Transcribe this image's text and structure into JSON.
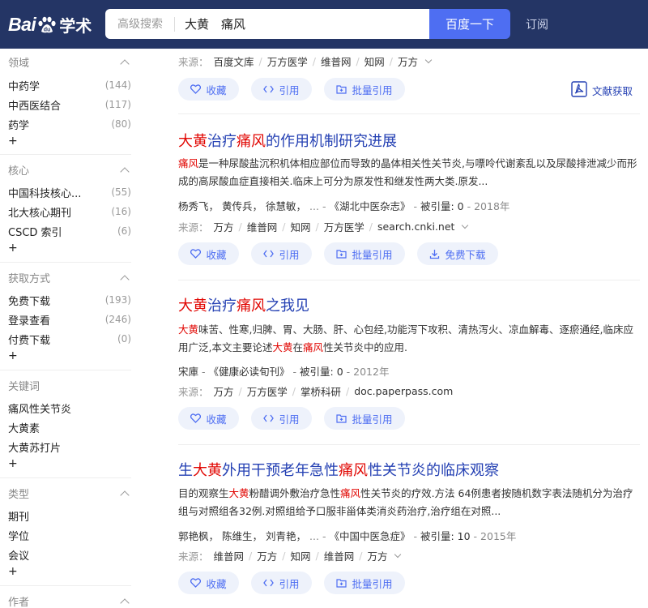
{
  "header": {
    "logo_text": "Bai",
    "logo_suffix": "学术",
    "advanced_search": "高级搜索",
    "query": "大黄　痛风",
    "search_button": "百度一下",
    "subscribe": "订阅"
  },
  "sidebar": {
    "groups": [
      {
        "title": "领域",
        "items": [
          {
            "label": "中药学",
            "count": "(144)"
          },
          {
            "label": "中西医结合",
            "count": "(117)"
          },
          {
            "label": "药学",
            "count": "(80)"
          }
        ],
        "more": "+"
      },
      {
        "title": "核心",
        "items": [
          {
            "label": "中国科技核心...",
            "count": "(55)"
          },
          {
            "label": "北大核心期刊",
            "count": "(16)"
          },
          {
            "label": "CSCD 索引",
            "count": "(6)"
          }
        ],
        "more": "+"
      },
      {
        "title": "获取方式",
        "items": [
          {
            "label": "免费下载",
            "count": "(193)"
          },
          {
            "label": "登录查看",
            "count": "(246)"
          },
          {
            "label": "付费下载",
            "count": "(0)"
          }
        ],
        "more": "+"
      },
      {
        "title": "关键词",
        "items": [
          {
            "label": "痛风性关节炎",
            "count": ""
          },
          {
            "label": "大黄素",
            "count": ""
          },
          {
            "label": "大黄苏打片",
            "count": ""
          }
        ],
        "more": "+"
      },
      {
        "title": "类型",
        "items": [
          {
            "label": "期刊",
            "count": ""
          },
          {
            "label": "学位",
            "count": ""
          },
          {
            "label": "会议",
            "count": ""
          }
        ],
        "more": "+"
      },
      {
        "title": "作者",
        "items": [],
        "more": ""
      }
    ]
  },
  "labels": {
    "source": "来源：",
    "collect": "收藏",
    "cite": "引用",
    "batch_cite": "批量引用",
    "free_download": "免费下载",
    "doc_fetch": "文献获取",
    "cited": "被引量:",
    "dash": "-",
    "sep": "/",
    "comma": "，",
    "ellipsis": "..."
  },
  "results": [
    {
      "sources": [
        "百度文库",
        "万方医学",
        "维普网",
        "知网",
        "万方"
      ]
    },
    {
      "title_parts": [
        [
          "大黄",
          true
        ],
        [
          "治疗",
          false
        ],
        [
          "痛风",
          true
        ],
        [
          "的作用机制研究进展",
          false
        ]
      ],
      "abstract_parts": [
        [
          "痛风",
          true
        ],
        [
          "是一种尿酸盐沉积机体相应部位而导致的晶体相关性关节炎,与嘌呤代谢紊乱以及尿酸排泄减少而形成的高尿酸血症直接相关.临床上可分为原发性和继发性两大类.原发...",
          false
        ]
      ],
      "authors": [
        "杨秀飞",
        "黄传兵",
        "徐慧敏"
      ],
      "journal": "《湖北中医杂志》",
      "cited": "0",
      "year": "2018年",
      "sources": [
        "万方",
        "维普网",
        "知网",
        "万方医学",
        "search.cnki.net"
      ]
    },
    {
      "title_parts": [
        [
          "大黄",
          true
        ],
        [
          "治疗",
          false
        ],
        [
          "痛风",
          true
        ],
        [
          "之我见",
          false
        ]
      ],
      "abstract_parts": [
        [
          "大黄",
          true
        ],
        [
          "味苦、性寒,归脾、胃、大肠、肝、心包经,功能泻下攻积、清热泻火、凉血解毒、逐瘀通经,临床应用广泛,本文主要论述",
          false
        ],
        [
          "大黄",
          true
        ],
        [
          "在",
          false
        ],
        [
          "痛风",
          true
        ],
        [
          "性关节炎中的应用.",
          false
        ]
      ],
      "authors": [
        "宋庫"
      ],
      "journal": "《健康必读旬刊》",
      "cited": "0",
      "year": "2012年",
      "sources": [
        "万方",
        "万方医学",
        "掌桥科研",
        "doc.paperpass.com"
      ]
    },
    {
      "title_parts": [
        [
          "生",
          false
        ],
        [
          "大黄",
          true
        ],
        [
          "外用干预老年急性",
          false
        ],
        [
          "痛风",
          true
        ],
        [
          "性关节炎的临床观察",
          false
        ]
      ],
      "abstract_parts": [
        [
          "目的观察生",
          false
        ],
        [
          "大黄",
          true
        ],
        [
          "粉醋调外敷治疗急性",
          false
        ],
        [
          "痛风",
          true
        ],
        [
          "性关节炎的疗效.方法 64例患者按随机数字表法随机分为治疗组与对照组各32例.对照组给予口服非甾体类消炎药治疗,治疗组在对照...",
          false
        ]
      ],
      "authors": [
        "郭艳枫",
        "陈维生",
        "刘青艳"
      ],
      "journal": "《中国中医急症》",
      "cited": "10",
      "year": "2015年",
      "sources": [
        "维普网",
        "万方",
        "知网",
        "维普网",
        "万方"
      ]
    }
  ]
}
